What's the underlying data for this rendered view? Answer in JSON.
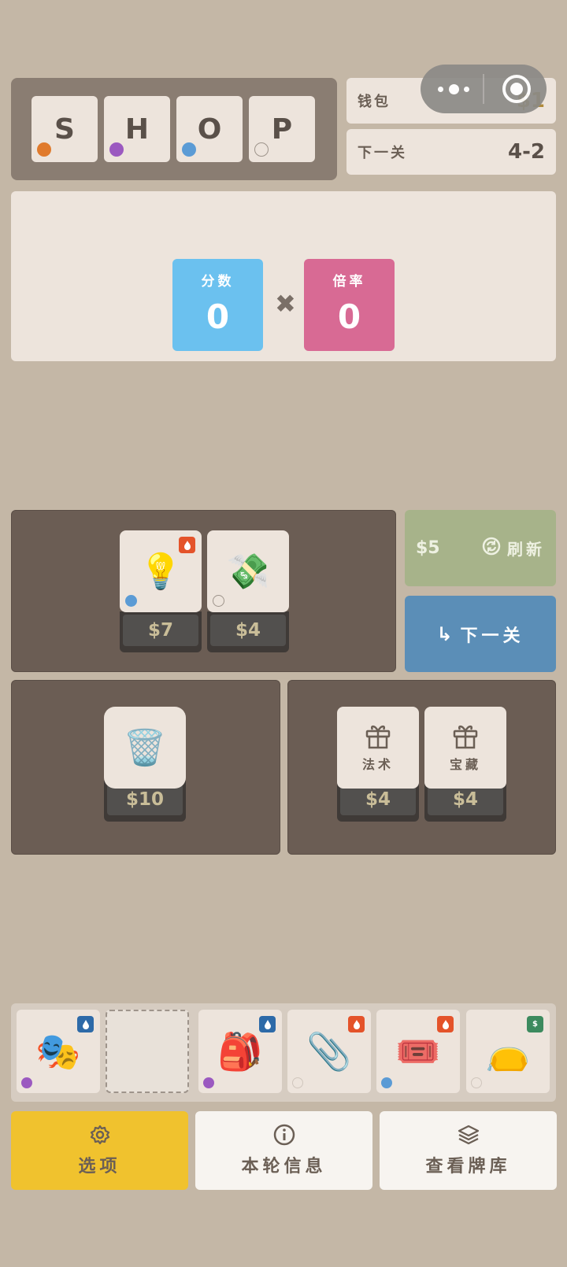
{
  "title": {
    "letters": [
      {
        "char": "S",
        "dot_color": "#e07a2c"
      },
      {
        "char": "H",
        "dot_color": "#9b59c0"
      },
      {
        "char": "O",
        "dot_color": "#5b9bd5"
      },
      {
        "char": "P",
        "dot_color": "#ede4dc"
      }
    ]
  },
  "wallet": {
    "label": "钱包",
    "value": "$1"
  },
  "next_level": {
    "label": "下一关",
    "value": "4-2"
  },
  "score": {
    "score_label": "分数",
    "score_value": "0",
    "score_color": "#6bc1ef",
    "mult_label": "倍率",
    "mult_value": "0",
    "mult_color": "#d86a94",
    "times_symbol": "✖"
  },
  "shop": {
    "items": [
      {
        "icon": "lightbulb-icon",
        "glyph": "💡",
        "price": "$7",
        "badge": "fire",
        "dot_color": "#5b9bd5"
      },
      {
        "icon": "money-wings-icon",
        "glyph": "💸",
        "price": "$4",
        "badge": "",
        "dot_color": "#ede4dc"
      }
    ],
    "refresh": {
      "cost": "$5",
      "label": "刷新"
    },
    "next": {
      "label": "下一关"
    },
    "voucher": {
      "icon": "trash-icon",
      "glyph": "🗑️",
      "price": "$10"
    },
    "packs": [
      {
        "label": "法术",
        "price": "$4"
      },
      {
        "label": "宝藏",
        "price": "$4"
      }
    ]
  },
  "inventory": [
    {
      "icon": "performing-arts-icon",
      "glyph": "🎭",
      "badge": "water",
      "badge_color": "#2d6aa8",
      "dot_color": "#9b59c0"
    },
    {
      "icon": "",
      "glyph": "",
      "badge": "",
      "dot_color": ""
    },
    {
      "icon": "backpack-icon",
      "glyph": "🎒",
      "badge": "water",
      "badge_color": "#2d6aa8",
      "dot_color": "#9b59c0"
    },
    {
      "icon": "paperclip-icon",
      "glyph": "📎",
      "badge": "fire",
      "badge_color": "#e4532a",
      "dot_color": "#ede4dc"
    },
    {
      "icon": "ticket-icon",
      "glyph": "🎟️",
      "badge": "fire",
      "badge_color": "#e4532a",
      "dot_color": "#5b9bd5"
    },
    {
      "icon": "purse-icon",
      "glyph": "👝",
      "badge": "money",
      "badge_color": "#3c8a5e",
      "dot_color": "#ede4dc"
    }
  ],
  "bottom": {
    "options": {
      "label": "选项",
      "color": "#f0c22e"
    },
    "round_info": {
      "label": "本轮信息"
    },
    "view_deck": {
      "label": "查看牌库"
    }
  }
}
